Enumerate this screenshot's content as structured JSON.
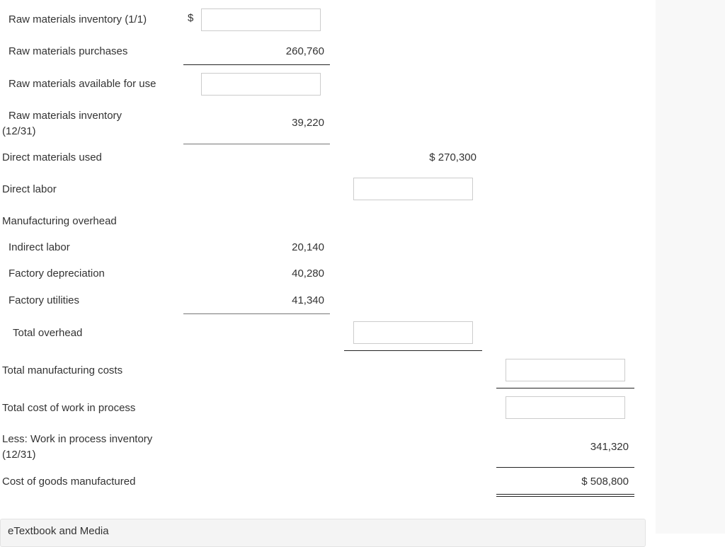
{
  "rows": {
    "rm_beginning": {
      "label": "Raw materials inventory (1/1)",
      "currency": "$",
      "value": ""
    },
    "rm_purchases": {
      "label": "Raw materials purchases",
      "value": "260,760"
    },
    "rm_available": {
      "label": "Raw materials available for use",
      "value": ""
    },
    "rm_ending": {
      "label_line1": "Raw materials inventory",
      "label_line2": "(12/31)",
      "value": "39,220"
    },
    "direct_materials": {
      "label": "Direct materials used",
      "value": "$ 270,300"
    },
    "direct_labor": {
      "label": "Direct labor",
      "value": ""
    },
    "overhead_header": {
      "label": "Manufacturing overhead"
    },
    "indirect_labor": {
      "label": "Indirect labor",
      "value": "20,140"
    },
    "factory_depreciation": {
      "label": "Factory depreciation",
      "value": "40,280"
    },
    "factory_utilities": {
      "label": "Factory utilities",
      "value": "41,340"
    },
    "total_overhead": {
      "label": "Total overhead",
      "value": ""
    },
    "total_mfg_costs": {
      "label": "Total manufacturing costs",
      "value": ""
    },
    "total_wip": {
      "label": "Total cost of work in process",
      "value": ""
    },
    "less_wip_ending": {
      "label_line1": "Less: Work in process inventory",
      "label_line2": "(12/31)",
      "value": "341,320"
    },
    "cogm": {
      "label": "Cost of goods manufactured",
      "value": "$ 508,800"
    }
  },
  "footer": {
    "label": "eTextbook and Media"
  }
}
